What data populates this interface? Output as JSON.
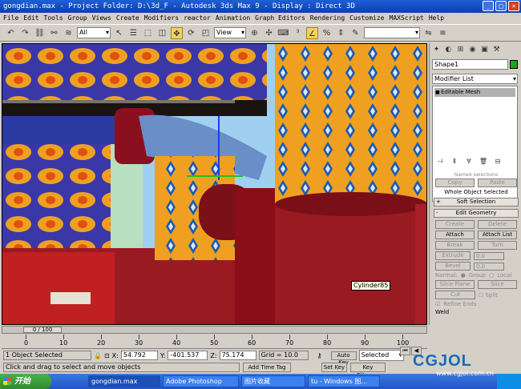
{
  "window": {
    "title": "gongdian.max    - Project Folder: D:\\3d_F     - Autodesk 3ds Max 9     - Display : Direct 3D"
  },
  "menu": [
    "File",
    "Edit",
    "Tools",
    "Group",
    "Views",
    "Create",
    "Modifiers",
    "reactor",
    "Animation",
    "Graph Editors",
    "Rendering",
    "Customize",
    "MAXScript",
    "Help"
  ],
  "toolbar": {
    "selection_filter": "All",
    "ref_coord": "View"
  },
  "viewport": {
    "tooltip": "Cylinder85"
  },
  "command_panel": {
    "object_name": "Shape1",
    "object_color": "#1aa51a",
    "modifier_list": "Modifier List",
    "stack_item": "Editable Mesh",
    "named_selections_title": "Named Selections",
    "copy": "Copy",
    "paste": "Paste",
    "whole_object_selected": "Whole Object Selected",
    "soft_selection": "Soft Selection",
    "edit_geometry": "Edit Geometry",
    "create": "Create",
    "delete": "Delete",
    "attach": "Attach",
    "attach_list": "Attach List",
    "break": "Break",
    "turn": "Turn",
    "extrude": "Extrude",
    "extrude_val": "0.0",
    "bevel": "Bevel",
    "bevel_val": "0.0",
    "normal_label": "Normal:",
    "group": "Group",
    "local": "Local",
    "slice_plane": "Slice Plane",
    "slice": "Slice",
    "cut": "Cut",
    "split": "Split",
    "refine_ends": "Refine Ends",
    "weld": "Weld"
  },
  "timeline": {
    "slider": "0 / 100",
    "ticks": [
      "0",
      "10",
      "20",
      "30",
      "40",
      "50",
      "60",
      "70",
      "80",
      "90",
      "100"
    ]
  },
  "status": {
    "selection": "1 Object Selected",
    "x_label": "X:",
    "x": "54.792",
    "y_label": "Y:",
    "y": "-401.537",
    "z_label": "Z:",
    "z": "75.174",
    "grid": "Grid = 10.0",
    "auto_key": "Auto Key",
    "selected": "Selected",
    "prompt": "Click and drag to select and move objects",
    "add_time_tag": "Add Time Tag",
    "set_key": "Set Key",
    "key_filters": "Key Filters..."
  },
  "taskbar": {
    "start": "开始",
    "items": [
      "gongdian.max",
      "Adobe Photoshop",
      "图片收藏",
      "tu - Windows 图..."
    ]
  },
  "watermark": {
    "logo": "CGJOL",
    "url": "www.cgjol.com.cn"
  }
}
